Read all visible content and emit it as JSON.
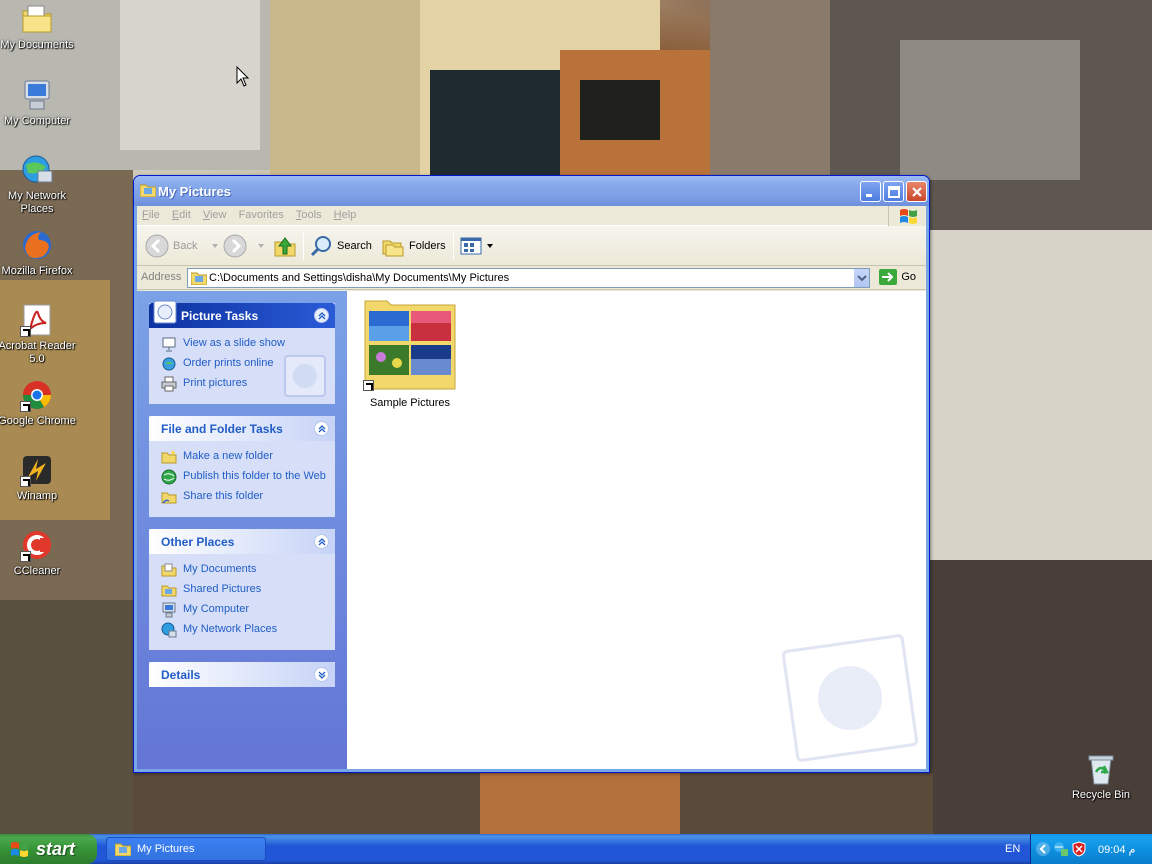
{
  "desktop": {
    "icons": [
      {
        "label": "My Documents",
        "icon": "my-documents-icon"
      },
      {
        "label": "My Computer",
        "icon": "my-computer-icon"
      },
      {
        "label": "My Network Places",
        "icon": "network-places-icon"
      },
      {
        "label": "Mozilla Firefox",
        "icon": "firefox-icon"
      },
      {
        "label": "Acrobat Reader 5.0",
        "icon": "acrobat-icon"
      },
      {
        "label": "Google Chrome",
        "icon": "chrome-icon"
      },
      {
        "label": "Winamp",
        "icon": "winamp-icon"
      },
      {
        "label": "CCleaner",
        "icon": "ccleaner-icon"
      },
      {
        "label": "Recycle Bin",
        "icon": "recycle-bin-icon"
      }
    ]
  },
  "window": {
    "title": "My Pictures",
    "menu": [
      {
        "accel": "F",
        "rest": "ile"
      },
      {
        "accel": "E",
        "rest": "dit"
      },
      {
        "accel": "V",
        "rest": "iew"
      },
      {
        "accel": "",
        "rest": "Favorites"
      },
      {
        "accel": "T",
        "rest": "ools"
      },
      {
        "accel": "H",
        "rest": "elp"
      }
    ],
    "toolbar": {
      "back": "Back",
      "search": "Search",
      "folders": "Folders"
    },
    "address": {
      "label": "Address",
      "value": "C:\\Documents and Settings\\disha\\My Documents\\My Pictures",
      "go": "Go"
    },
    "taskpane": {
      "picture_tasks": {
        "title": "Picture Tasks",
        "links": [
          "View as a slide show",
          "Order prints online",
          "Print pictures"
        ]
      },
      "file_folder_tasks": {
        "title": "File and Folder Tasks",
        "links": [
          "Make a new folder",
          "Publish this folder to the Web",
          "Share this folder"
        ]
      },
      "other_places": {
        "title": "Other Places",
        "links": [
          "My Documents",
          "Shared Pictures",
          "My Computer",
          "My Network Places"
        ]
      },
      "details": {
        "title": "Details"
      }
    },
    "files": [
      {
        "name": "Sample Pictures"
      }
    ]
  },
  "taskbar": {
    "start": "start",
    "task": "My Pictures",
    "language": "EN",
    "clock": "09:04 م"
  },
  "colors": {
    "xp_blue": "#0a5ce6",
    "taskpane_link": "#215dc6",
    "start_green": "#379437"
  }
}
